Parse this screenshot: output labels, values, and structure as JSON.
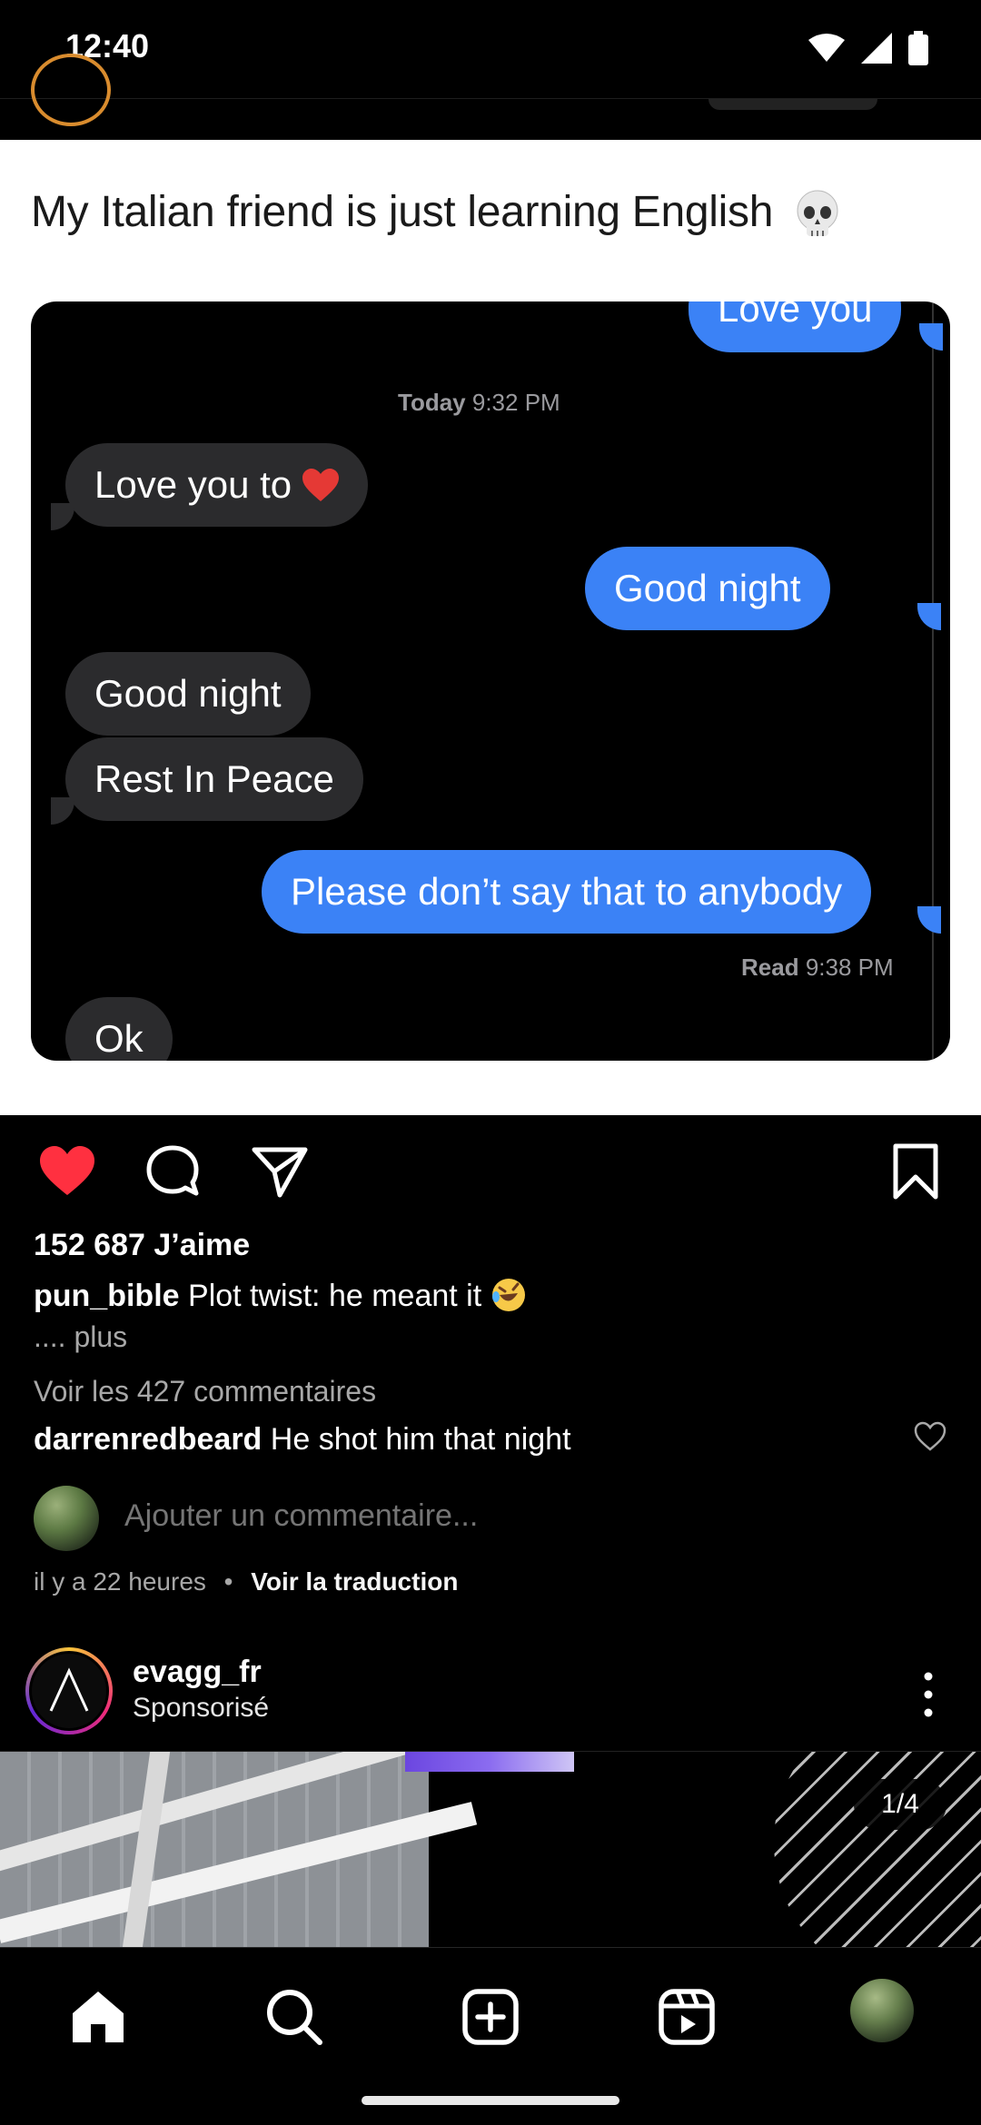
{
  "status_bar": {
    "time": "12:40"
  },
  "post": {
    "caption_text": "My Italian friend is just learning English",
    "chat": {
      "top_bubble": "Love you",
      "timestamp_day": "Today",
      "timestamp_time": "9:32 PM",
      "msg_in_1": "Love you to",
      "msg_out_1": "Good night",
      "msg_in_2": "Good night",
      "msg_in_3": "Rest In Peace",
      "msg_out_2": "Please don’t say that to anybody",
      "read_label": "Read",
      "read_time": "9:38 PM",
      "msg_in_4": "Ok"
    },
    "likes": "152 687 J’aime",
    "author": "pun_bible",
    "author_caption": "Plot twist: he meant it",
    "more": ".... plus",
    "view_comments": "Voir les 427 commentaires",
    "top_comment_user": "darrenredbeard",
    "top_comment_text": "He shot him that night",
    "add_comment_placeholder": "Ajouter un commentaire...",
    "time_ago": "il y a 22 heures",
    "translate": "Voir la traduction"
  },
  "next_post": {
    "username": "evagg_fr",
    "subtitle": "Sponsorisé",
    "counter": "1/4"
  },
  "icons": {
    "like": "heart-filled-icon",
    "comment": "comment-icon",
    "share": "send-icon",
    "save": "bookmark-icon"
  },
  "colors": {
    "like_red": "#ff3040",
    "bubble_blue": "#3b82f6",
    "bubble_gray": "#2b2b2d"
  }
}
